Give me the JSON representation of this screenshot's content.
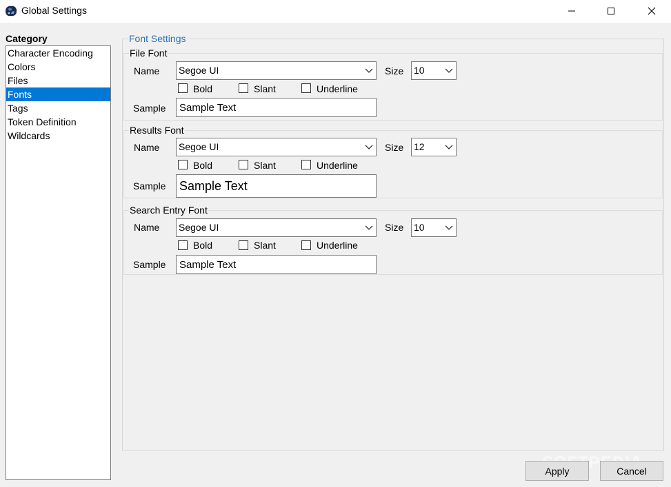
{
  "window": {
    "title": "Global Settings",
    "controls": [
      "minimize",
      "maximize",
      "close"
    ]
  },
  "category": {
    "label": "Category",
    "items": [
      "Character Encoding",
      "Colors",
      "Files",
      "Fonts",
      "Tags",
      "Token Definition",
      "Wildcards"
    ],
    "selected": "Fonts",
    "selected_color": "#0078d7"
  },
  "font_settings": {
    "title": "Font Settings",
    "groups": [
      {
        "title": "File Font",
        "name_label": "Name",
        "name_value": "Segoe UI",
        "size_label": "Size",
        "size_value": "10",
        "bold_label": "Bold",
        "slant_label": "Slant",
        "underline_label": "Underline",
        "sample_label": "Sample",
        "sample_text": "Sample Text"
      },
      {
        "title": "Results Font",
        "name_label": "Name",
        "name_value": "Segoe UI",
        "size_label": "Size",
        "size_value": "12",
        "bold_label": "Bold",
        "slant_label": "Slant",
        "underline_label": "Underline",
        "sample_label": "Sample",
        "sample_text": "Sample Text"
      },
      {
        "title": "Search Entry Font",
        "name_label": "Name",
        "name_value": "Segoe UI",
        "size_label": "Size",
        "size_value": "10",
        "bold_label": "Bold",
        "slant_label": "Slant",
        "underline_label": "Underline",
        "sample_label": "Sample",
        "sample_text": "Sample Text"
      }
    ]
  },
  "buttons": {
    "apply": "Apply",
    "cancel": "Cancel"
  },
  "watermark": "SOFTPEDIA"
}
